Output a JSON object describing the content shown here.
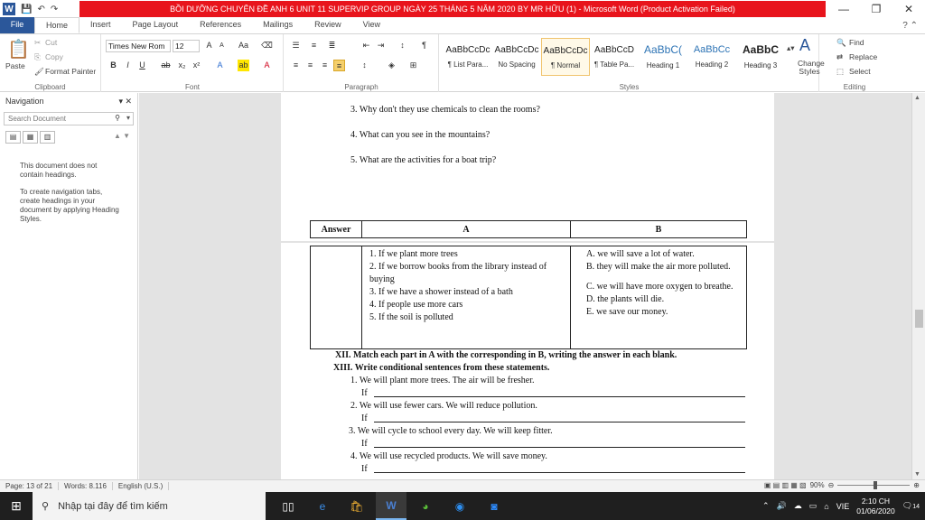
{
  "window": {
    "title": "BỒI DƯỠNG CHUYÊN ĐỀ ANH 6 UNIT 11 SUPERVIP GROUP NGÀY 25 THÁNG 5 NĂM 2020 BY MR HỮU (1) - Microsoft Word (Product Activation Failed)",
    "minimize": "—",
    "restore": "❐",
    "close": "✕"
  },
  "tabs": [
    "File",
    "Home",
    "Insert",
    "Page Layout",
    "References",
    "Mailings",
    "Review",
    "View"
  ],
  "ribbon": {
    "clipboard": {
      "label": "Clipboard",
      "paste": "Paste",
      "cut": "Cut",
      "copy": "Copy",
      "format_painter": "Format Painter"
    },
    "font": {
      "label": "Font",
      "name": "Times New Rom",
      "size": "12"
    },
    "paragraph": {
      "label": "Paragraph"
    },
    "styles": {
      "label": "Styles",
      "items": [
        {
          "sample": "AaBbCcDc",
          "name": "¶ List Para..."
        },
        {
          "sample": "AaBbCcDc",
          "name": "No Spacing"
        },
        {
          "sample": "AaBbCcDc",
          "name": "¶ Normal"
        },
        {
          "sample": "AaBbCcD",
          "name": "¶ Table Pa..."
        },
        {
          "sample": "AaBbC(",
          "name": "Heading 1"
        },
        {
          "sample": "AaBbCc",
          "name": "Heading 2"
        },
        {
          "sample": "AaBbC",
          "name": "Heading 3"
        }
      ],
      "change": "Change Styles"
    },
    "editing": {
      "label": "Editing",
      "find": "Find",
      "replace": "Replace",
      "select": "Select"
    }
  },
  "navigation": {
    "title": "Navigation",
    "search_placeholder": "Search Document",
    "msg1": "This document does not contain headings.",
    "msg2": "To create navigation tabs, create headings in your document by applying Heading Styles."
  },
  "document": {
    "questions": [
      "3.  Why don't they use chemicals to clean the rooms?",
      "4.  What can you see in the mountains?",
      "5.  What are the activities for a boat trip?"
    ],
    "table": {
      "headers": [
        "Answer",
        "A",
        "B"
      ],
      "colA": [
        "1.  If we plant more trees",
        "2.  If we borrow books from the library instead of buying",
        "3.  If we have a shower instead of a bath",
        "4.  If people use more cars",
        "5.  If the soil is polluted"
      ],
      "colB": [
        "A.  we will save a lot of water.",
        "B.   they will make the air more polluted.",
        "C.   we will have more oxygen to breathe.",
        "D.  the plants will die.",
        "E.  we save our money."
      ]
    },
    "ex12": "XII.   Match each part in A with the corresponding in B, writing the answer in each blank.",
    "ex13": "XIII.  Write conditional sentences from these statements.",
    "sentences": [
      "1.  We will plant more trees. The air will be fresher.",
      "2.  We will use fewer cars. We will reduce pollution.",
      "3.  We will cycle to school every day. We will keep fitter.",
      "4.  We will use recycled products. We will save money."
    ],
    "if_word": "If"
  },
  "status": {
    "page": "Page: 13 of 21",
    "words": "Words: 8.116",
    "lang": "English (U.S.)",
    "zoom": "90%"
  },
  "taskbar": {
    "search_placeholder": "Nhập tại đây để tìm kiếm",
    "lang": "VIE",
    "time": "2:10 CH",
    "date": "01/06/2020",
    "notif_count": "14"
  }
}
